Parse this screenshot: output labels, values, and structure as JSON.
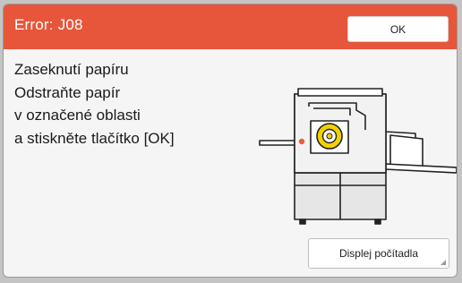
{
  "dialog": {
    "title": "Error: J08",
    "ok_label": "OK",
    "message_lines": [
      "Zaseknutí papíru",
      "Odstraňte papír",
      "v označené oblasti",
      "a stiskněte tlačítko [OK]"
    ],
    "counter_button_label": "Displej počítadla"
  },
  "colors": {
    "title_bar": "#e7563a",
    "jam_marker": "#f05a3c",
    "jam_indicator_ring": "#f2d200"
  },
  "icons": {
    "printer": "printer-illustration-icon",
    "jam_location": "jam-location-icon"
  }
}
